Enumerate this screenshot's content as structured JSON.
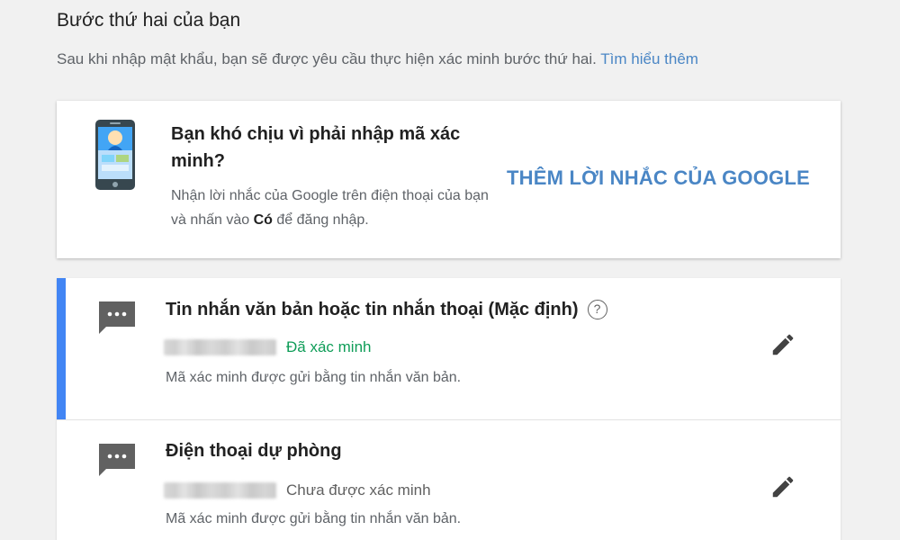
{
  "section": {
    "title": "Bước thứ hai của bạn",
    "description": "Sau khi nhập mật khẩu, bạn sẽ được yêu cầu thực hiện xác minh bước thứ hai.",
    "learn_more": "Tìm hiểu thêm"
  },
  "promo": {
    "icon": "phone-illustration",
    "title": "Bạn khó chịu vì phải nhập mã xác minh?",
    "desc_before": "Nhận lời nhắc của Google trên điện thoại của bạn và nhấn vào ",
    "desc_bold": "Có",
    "desc_after": " để đăng nhập.",
    "action": "THÊM LỜI NHẮC CỦA GOOGLE"
  },
  "methods": [
    {
      "icon": "chat-icon",
      "title": "Tin nhắn văn bản hoặc tin nhắn thoại (Mặc định)",
      "help": "?",
      "status": "Đã xác minh",
      "description": "Mã xác minh được gửi bằng tin nhắn văn bản.",
      "edit_icon": "pencil-icon"
    },
    {
      "icon": "chat-icon",
      "title": "Điện thoại dự phòng",
      "status": "Chưa được xác minh",
      "description": "Mã xác minh được gửi bằng tin nhắn văn bản.",
      "edit_icon": "pencil-icon"
    }
  ],
  "colors": {
    "accent": "#4285f4",
    "link": "#4a86c5",
    "verified": "#0f9d58",
    "background": "#f1f1f1"
  }
}
